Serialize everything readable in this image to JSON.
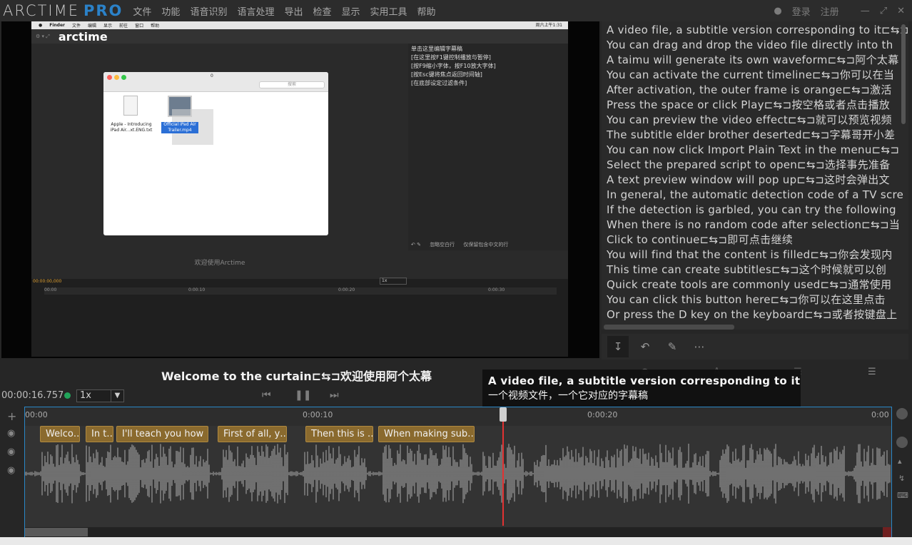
{
  "app": {
    "logo_text": "ARCTIME",
    "logo_pro": "PRO"
  },
  "menu": [
    "文件",
    "功能",
    "语音识别",
    "语言处理",
    "导出",
    "检查",
    "显示",
    "实用工具",
    "帮助"
  ],
  "user": {
    "login": "登录",
    "register": "注册"
  },
  "inner_screen": {
    "mac_menu": [
      "Finder",
      "文件",
      "编辑",
      "显示",
      "前往",
      "窗口",
      "帮助"
    ],
    "mac_clock": "周六上午1:31",
    "inner_logo": "arctime",
    "finder_folder": "0",
    "finder_search": "搜索",
    "finder_files": [
      {
        "name": "Apple - Introducing iPad Air...xt.ENG.txt"
      },
      {
        "name": "Official iPad Air Trailer.mp4"
      }
    ],
    "side_list": [
      "单击这里编辑字幕稿",
      "[在这里按F1键控制播放与暂停]",
      "[按F9缩小字体，按F10放大字体]",
      "[按Esc键将焦点返回时间轴]",
      "[在底部设定过滤条件]"
    ],
    "welcome": "欢迎使用Arctime",
    "checkbox1": "忽略空白行",
    "checkbox2": "仅保留包含中文的行",
    "timecode": "00:00:00,000",
    "speed": "1x",
    "ticks": [
      "00:00",
      "0:00:10",
      "0:00:20",
      "0:00:30"
    ]
  },
  "script_lines": [
    "A video file, a subtitle version corresponding to it⊏⇆⊐",
    "You can drag and drop the video file directly into th",
    "A taimu will generate its own waveform⊏⇆⊐阿个太幕",
    "You can activate the current timeline⊏⇆⊐你可以在当",
    "After activation, the outer frame is orange⊏⇆⊐激活",
    "Press the space or click Play⊏⇆⊐按空格或者点击播放",
    "You can preview the video effect⊏⇆⊐就可以预览视频",
    "The subtitle elder brother deserted⊏⇆⊐字幕哥开小差",
    "You can now click Import Plain Text in the menu⊏⇆⊐",
    "Select the prepared script to open⊏⇆⊐选择事先准备",
    "A text preview window will pop up⊏⇆⊐这时会弹出文",
    "In general, the automatic detection code of a TV scre",
    "If the detection is garbled, you can try the following",
    "When there is no random code after selection⊏⇆⊐当",
    "Click to continue⊏⇆⊐即可点击继续",
    "You will find that the content is filled⊏⇆⊐你会发现内",
    "This time can create subtitles⊏⇆⊐这个时候就可以创",
    "Quick create tools are commonly used⊏⇆⊐通常使用",
    "You can click this button here⊏⇆⊐你可以在这里点击",
    "Or press the D key on the keyboard⊏⇆⊐或者按键盘上"
  ],
  "subtitle_overlay": "Welcome to the curtain⊏⇆⊐欢迎使用阿个太幕",
  "controls": {
    "timecode": "00:00:16.757",
    "speed": "1x"
  },
  "tooltip": {
    "en": "A video file, a subtitle version corresponding to it",
    "zh": "一个视频文件，一个它对应的字幕稿"
  },
  "ruler_ticks": [
    "00:00",
    "0:00:10",
    "0:00:20",
    "0:00"
  ],
  "segments": [
    {
      "label": "Welco…"
    },
    {
      "label": "In t…"
    },
    {
      "label": "I'll teach you how"
    },
    {
      "label": "First of all, y…"
    },
    {
      "label": "Then this is …"
    },
    {
      "label": "When making sub…"
    }
  ],
  "colors": {
    "accent": "#2b82c9",
    "segment": "#8a6a2e",
    "playhead": "#e23232",
    "status_dot": "#21a35a"
  }
}
